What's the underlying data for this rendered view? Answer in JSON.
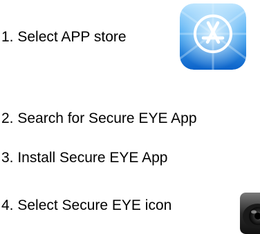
{
  "steps": [
    {
      "text": "1. Select APP store",
      "icon": "app-store-icon"
    },
    {
      "text": "2. Search for Secure EYE App"
    },
    {
      "text": "3. Install Secure EYE App"
    },
    {
      "text": "4. Select Secure EYE icon",
      "icon": "secure-eye-app-icon"
    }
  ],
  "colors": {
    "text": "#000000",
    "app_store_blue": "#1a86e8",
    "app_store_light": "#8fd0ff"
  }
}
